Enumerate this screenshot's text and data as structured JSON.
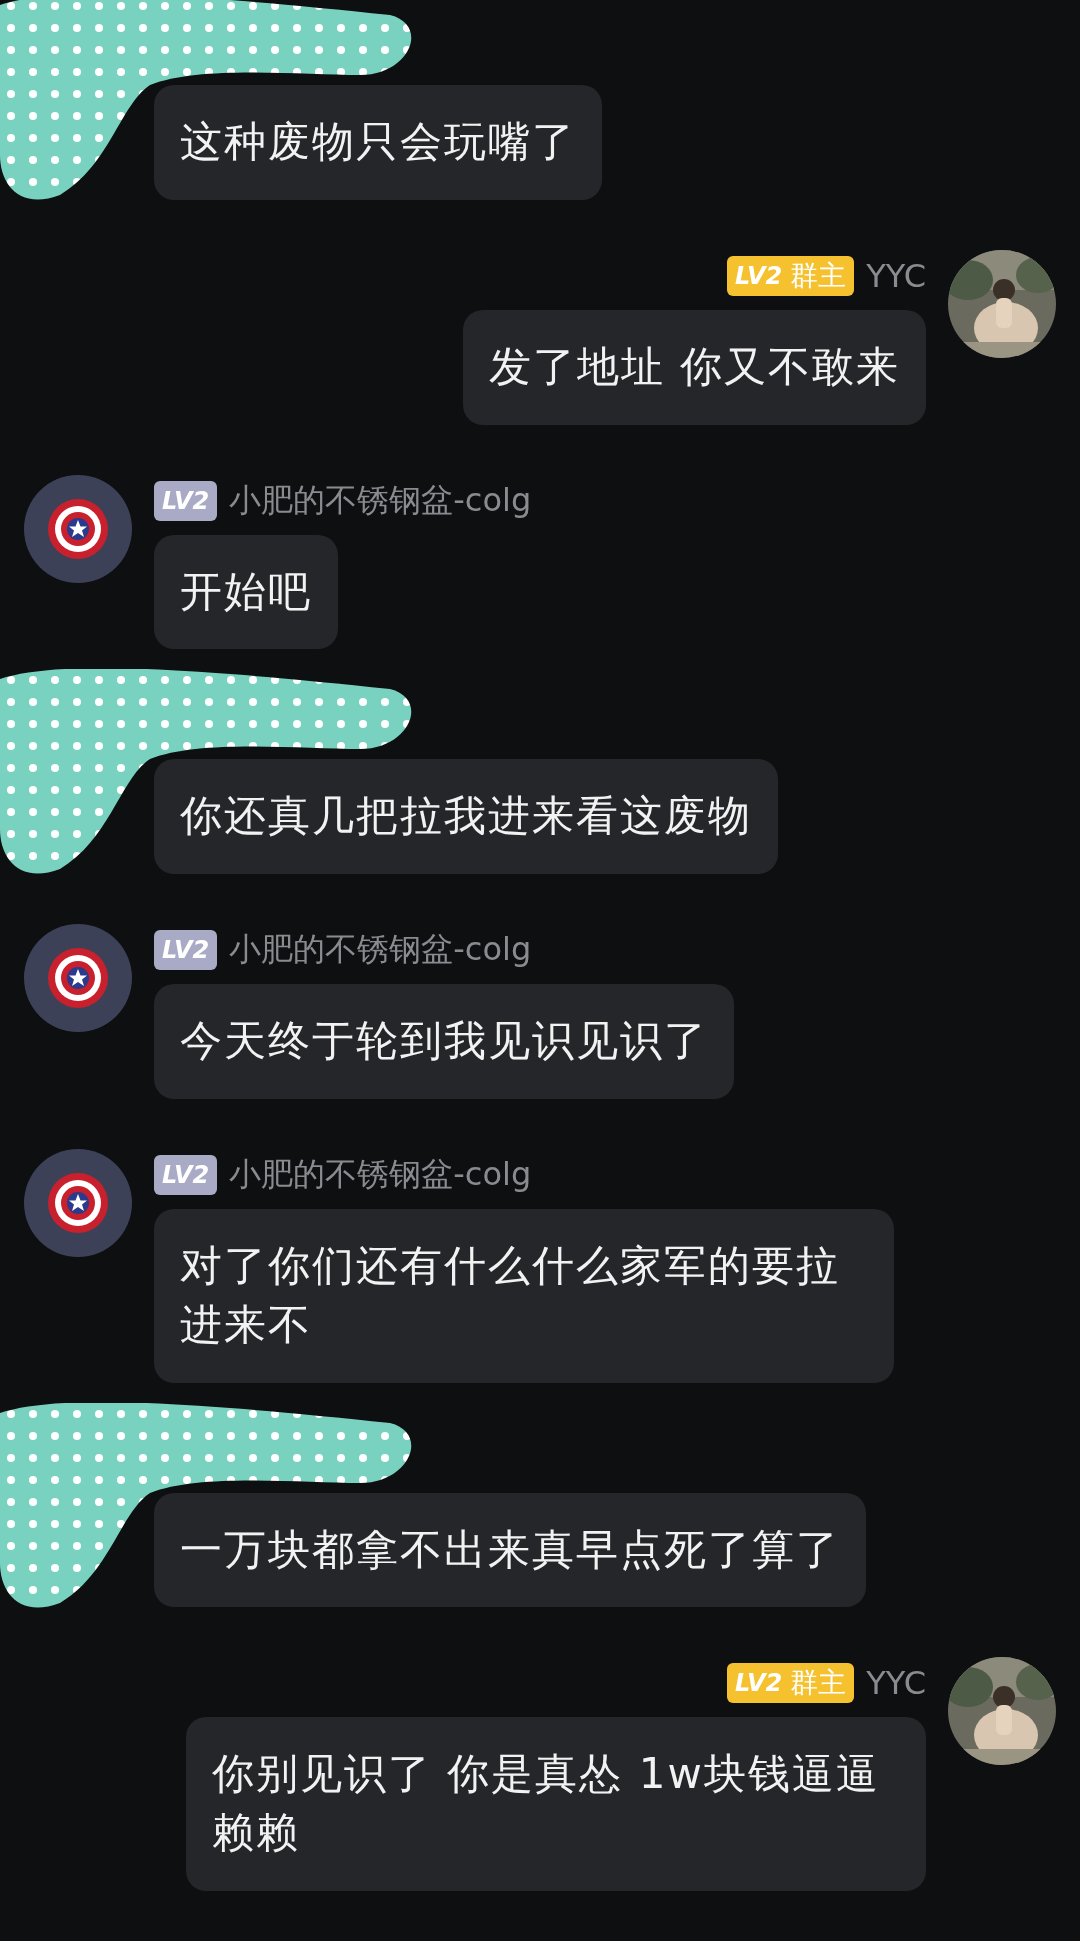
{
  "messages": [
    {
      "kind": "incoming",
      "redacted": true,
      "text": "这种废物只会玩嘴了"
    },
    {
      "kind": "outgoing",
      "redacted": false,
      "badge": "LV2",
      "role": "群主",
      "name": "YYC",
      "text": "发了地址 你又不敢来"
    },
    {
      "kind": "incoming",
      "redacted": false,
      "avatar": {
        "kind": "shield"
      },
      "badge": "LV2",
      "name": "小肥的不锈钢盆-colg",
      "text": "开始吧"
    },
    {
      "kind": "incoming",
      "redacted": true,
      "text": "你还真几把拉我进来看这废物"
    },
    {
      "kind": "incoming",
      "redacted": false,
      "avatar": {
        "kind": "shield"
      },
      "badge": "LV2",
      "name": "小肥的不锈钢盆-colg",
      "text": "今天终于轮到我见识见识了"
    },
    {
      "kind": "incoming",
      "redacted": false,
      "avatar": {
        "kind": "shield"
      },
      "badge": "LV2",
      "name": "小肥的不锈钢盆-colg",
      "text": "对了你们还有什么什么家军的要拉进来不"
    },
    {
      "kind": "incoming",
      "redacted": true,
      "text": "一万块都拿不出来真早点死了算了"
    },
    {
      "kind": "outgoing",
      "redacted": false,
      "badge": "LV2",
      "role": "群主",
      "name": "YYC",
      "text": "你别见识了 你是真怂 1w块钱逼逼赖赖"
    }
  ]
}
